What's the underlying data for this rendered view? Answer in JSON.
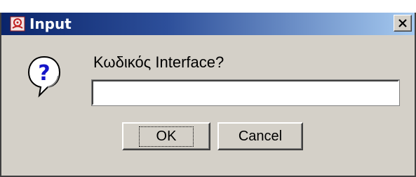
{
  "window": {
    "title": "Input",
    "close_label": "✕"
  },
  "dialog": {
    "icon": "question-icon",
    "prompt": "Κωδικός Interface?",
    "input_value": "",
    "ok_label": "OK",
    "cancel_label": "Cancel"
  },
  "colors": {
    "titlebar_start": "#0a246a",
    "titlebar_end": "#a6caf0",
    "dialog_bg": "#d4d0c8",
    "question_icon_fill": "#1414c8"
  }
}
